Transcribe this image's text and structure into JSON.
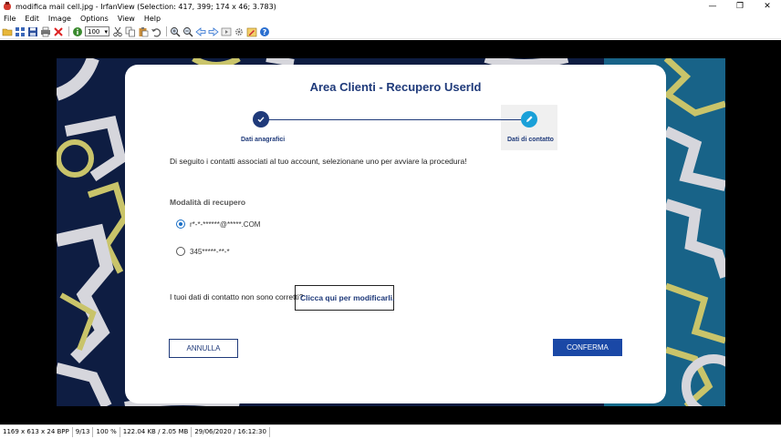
{
  "window": {
    "title": "modifica mail cell.jpg - IrfanView (Selection: 417, 399; 174 x 46; 3.783)",
    "minimize_glyph": "—",
    "maximize_glyph": "❐",
    "close_glyph": "✕"
  },
  "menu": [
    "File",
    "Edit",
    "Image",
    "Options",
    "View",
    "Help"
  ],
  "toolbar": {
    "zoom_value": "100",
    "icons": [
      "open-folder-icon",
      "thumbnails-icon",
      "save-icon",
      "print-icon",
      "delete-icon",
      "info-icon",
      "cut-icon",
      "copy-icon",
      "paste-icon",
      "undo-icon",
      "zoom-in-icon",
      "zoom-out-icon",
      "previous-icon",
      "next-icon",
      "slideshow-icon",
      "settings-icon",
      "help-icon"
    ],
    "accent": "#2a6fd0"
  },
  "card": {
    "title": "Area Clienti - Recupero UserId",
    "steps": [
      {
        "label": "Dati anagrafici",
        "state": "completed",
        "icon": "check-icon"
      },
      {
        "label": "Dati di contatto",
        "state": "active",
        "icon": "pencil-icon"
      }
    ],
    "intro": "Di seguito i contatti associati al tuo account, selezionane uno per avviare la procedura!",
    "section_label": "Modalità di recupero",
    "options": [
      {
        "label": "r*-*-******@*****.COM",
        "selected": true
      },
      {
        "label": "345*****-**-*",
        "selected": false
      }
    ],
    "contact_note": "I tuoi dati di contatto non sono corretti?",
    "edit_link": "Clicca qui per modificarli.",
    "cancel_label": "ANNULLA",
    "confirm_label": "CONFERMA",
    "colors": {
      "primary": "#1f3a7a",
      "button": "#1a48a6",
      "active_step": "#1aa0d8",
      "background": "#0e1d42",
      "gear_yellow": "#c9c46a",
      "gear_grey": "#d6d6dc",
      "teal": "#136b8c"
    }
  },
  "status": {
    "cells": [
      "1169 x 613 x 24 BPP",
      "9/13",
      "100 %",
      "122.04 KB / 2.05 MB",
      "29/06/2020 / 16:12:30"
    ]
  }
}
